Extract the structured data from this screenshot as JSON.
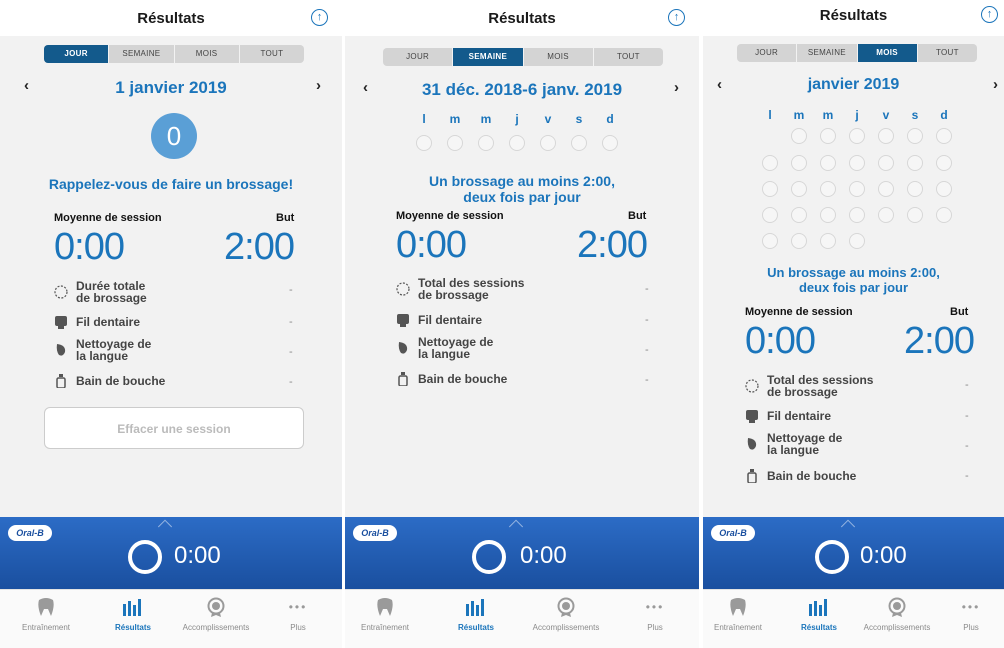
{
  "header": {
    "title": "Résultats",
    "up_icon": "upload-arrow-icon"
  },
  "segments": [
    "JOUR",
    "SEMAINE",
    "MOIS",
    "TOUT"
  ],
  "panel1": {
    "date": "1 janvier 2019",
    "count": "0",
    "reminder": "Rappelez-vous de faire un brossage!",
    "session_avg_label": "Moyenne de session",
    "goal_label": "But",
    "session_avg": "0:00",
    "goal": "2:00",
    "rows": [
      {
        "label1": "Durée totale",
        "label2": "de brossage",
        "value": "-"
      },
      {
        "label1": "Fil dentaire",
        "label2": "",
        "value": "-"
      },
      {
        "label1": "Nettoyage de",
        "label2": "la langue",
        "value": "-"
      },
      {
        "label1": "Bain de bouche",
        "label2": "",
        "value": "-"
      }
    ],
    "clear_button": "Effacer une session"
  },
  "panel2": {
    "date": "31 déc. 2018-6 janv. 2019",
    "weekdays": [
      "l",
      "m",
      "m",
      "j",
      "v",
      "s",
      "d"
    ],
    "goal_text_1": "Un brossage au moins 2:00,",
    "goal_text_2": "deux fois par jour",
    "session_avg_label": "Moyenne de session",
    "goal_label": "But",
    "session_avg": "0:00",
    "goal": "2:00",
    "rows": [
      {
        "label1": "Total des sessions",
        "label2": "de brossage",
        "value": "-"
      },
      {
        "label1": "Fil dentaire",
        "label2": "",
        "value": "-"
      },
      {
        "label1": "Nettoyage de",
        "label2": "la langue",
        "value": "-"
      },
      {
        "label1": "Bain de bouche",
        "label2": "",
        "value": "-"
      }
    ]
  },
  "panel3": {
    "date": "janvier 2019",
    "weekdays": [
      "l",
      "m",
      "m",
      "j",
      "v",
      "s",
      "d"
    ],
    "goal_text_1": "Un brossage au moins 2:00,",
    "goal_text_2": "deux fois par jour",
    "session_avg_label": "Moyenne de session",
    "goal_label": "But",
    "session_avg": "0:00",
    "goal": "2:00",
    "rows": [
      {
        "label1": "Total des sessions",
        "label2": "de brossage",
        "value": "-"
      },
      {
        "label1": "Fil dentaire",
        "label2": "",
        "value": "-"
      },
      {
        "label1": "Nettoyage de",
        "label2": "la langue",
        "value": "-"
      },
      {
        "label1": "Bain de bouche",
        "label2": "",
        "value": "-"
      }
    ]
  },
  "footer": {
    "logo": "Oral-B",
    "timer": "0:00"
  },
  "tabs": [
    {
      "label": "Entraînement",
      "icon": "tooth-icon"
    },
    {
      "label": "Résultats",
      "icon": "bar-chart-icon"
    },
    {
      "label": "Accomplissements",
      "icon": "medal-icon"
    },
    {
      "label": "Plus",
      "icon": "more-dots-icon"
    }
  ],
  "colors": {
    "accent": "#1b75bb",
    "segment_active": "#135a8c",
    "footer": "#2162b5"
  }
}
